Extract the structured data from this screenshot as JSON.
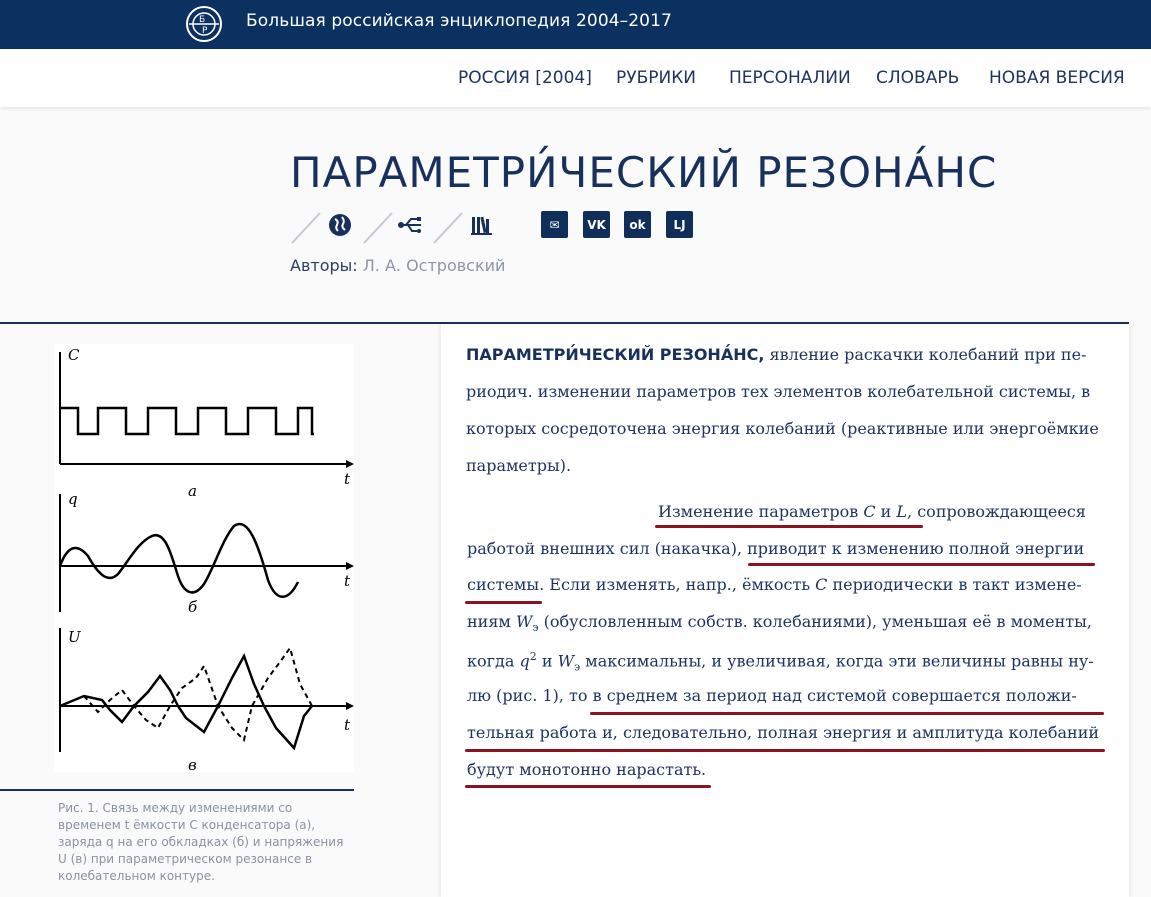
{
  "header": {
    "site_title": "Большая российская энциклопедия 2004–2017",
    "logo": "bre-logo-icon"
  },
  "nav": {
    "items": [
      "РОССИЯ [2004]",
      "РУБРИКИ",
      "ПЕРСОНАЛИИ",
      "СЛОВАРЬ",
      "НОВАЯ ВЕРСИЯ"
    ]
  },
  "article": {
    "title": "ПАРАМЕТРИ́ЧЕСКИЙ РЕЗОНА́НС",
    "authors_label": "Авторы:",
    "authors_value": "Л. А. Островский",
    "icons": [
      "globe-icon",
      "usb-icon",
      "books-icon"
    ],
    "share": [
      "mail-icon",
      "vk-icon",
      "ok-icon",
      "lj-icon"
    ],
    "share_glyphs": [
      "✉",
      "VK",
      "ok",
      "LJ"
    ],
    "para1": {
      "lines": [
        "явление раскачки колебаний при пе-",
        "риодич. изменении параметров тех элементов колебательной системы, в",
        "которых сосредоточена энергия колебаний (реактивные или энергоёмкие",
        "параметры)."
      ],
      "term": "ПАРАМЕТРИ́ЧЕСКИЙ РЕЗОНА́НС,"
    },
    "para2": {
      "l1_a": "Изменение параметров ",
      "l1_c": "C",
      "l1_and": " и ",
      "l1_l": "L",
      "l1_b": ", сопровождающееся",
      "l2_a": "работой внешних сил (накачка), ",
      "l2_b": "приводит к изменению полной энергии",
      "l3_a": "системы",
      "l3_b": ". Если изменять, напр., ёмкость ",
      "l3_c": "C",
      "l3_d": " периодически в такт измене-",
      "l4_a": "ниям ",
      "l4_w": "W",
      "l4_sub": "э",
      "l4_b": " (обусловленным собств. колебаниями), уменьшая её в моменты,",
      "l5_a": "когда ",
      "l5_q": "q",
      "l5_sup": "2",
      "l5_and": " и ",
      "l5_w": "W",
      "l5_sub": "э",
      "l5_b": " максимальны, и увеличивая, когда эти величины равны ну-",
      "l6_a": "лю (рис. 1), то ",
      "l6_b": "в среднем за период над системой совершается положи-",
      "l7": "тельная работа и, следовательно, полная энергия и амплитуда колебаний",
      "l8": "будут монотонно нарастать."
    }
  },
  "figure": {
    "labels": {
      "c": "C",
      "q": "q",
      "u": "U",
      "t": "t",
      "a": "а",
      "b": "б",
      "v": "в"
    },
    "caption": "Рис. 1. Связь между изменениями со временем t ёмкости С конденсатора (а), заряда q на его обкладках (б) и напряжения U (в) при параметрическом резонансе в колебательном контуре."
  },
  "colors": {
    "topbar": "#0b3161",
    "accent_underline": "#8b1320",
    "text": "#1f3460"
  }
}
